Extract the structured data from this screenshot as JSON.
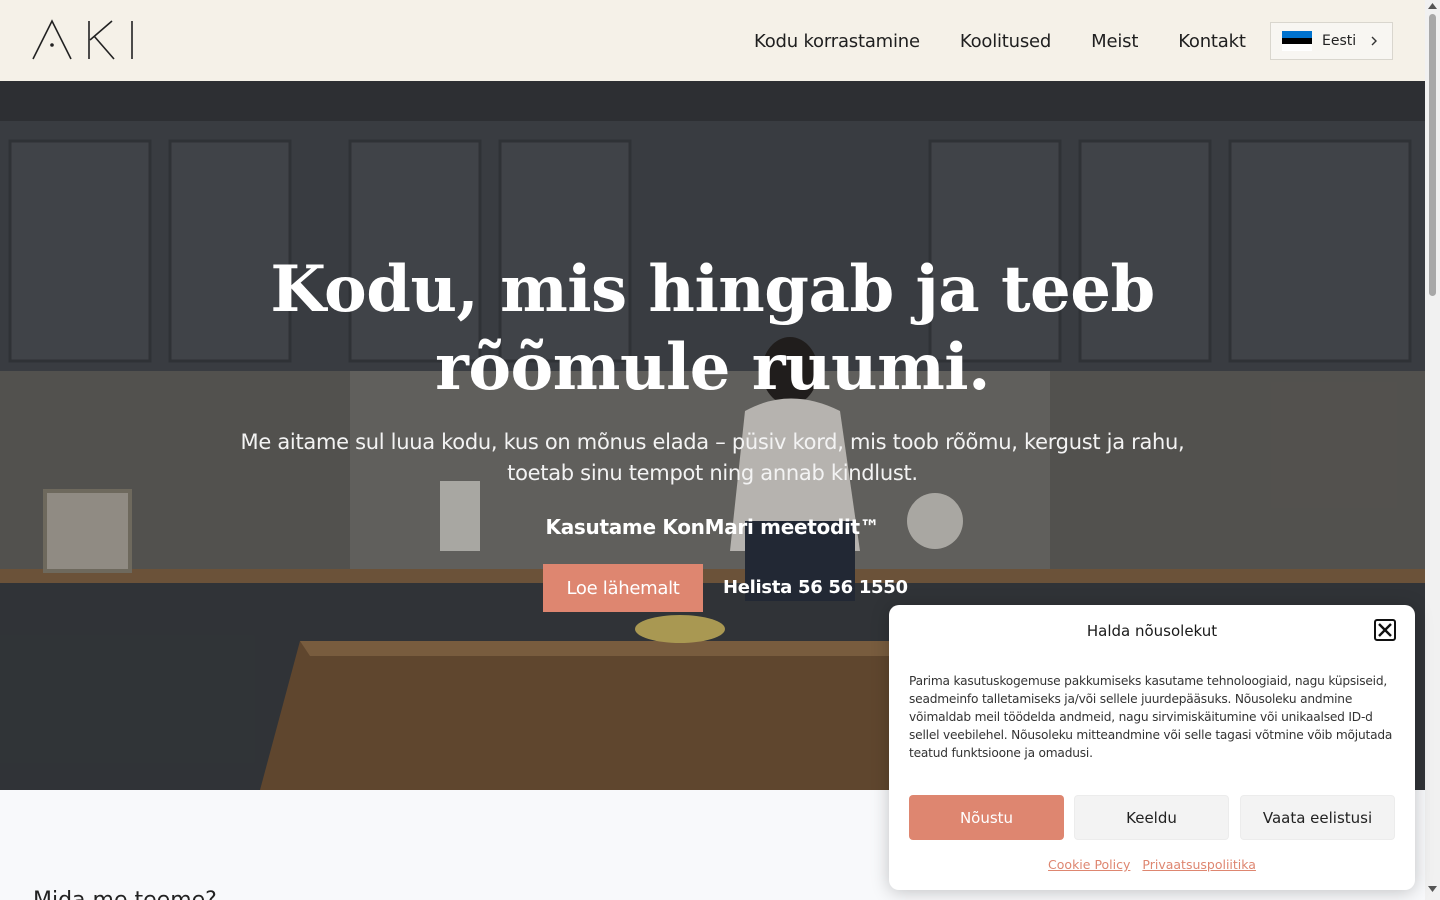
{
  "header": {
    "logo_text": "AKI",
    "nav": [
      {
        "label": "Kodu korrastamine"
      },
      {
        "label": "Koolitused"
      },
      {
        "label": "Meist"
      },
      {
        "label": "Kontakt"
      }
    ],
    "language": {
      "label": "Eesti",
      "flag_colors": [
        "#0072ce",
        "#000000",
        "#ffffff"
      ]
    }
  },
  "hero": {
    "title": "Kodu, mis hingab ja teeb rõõmule ruumi.",
    "subtitle": "Me aitame sul luua kodu, kus on mõnus elada – püsiv kord, mis toob rõõmu, kergust ja rahu, toetab sinu tempot ning annab kindlust.",
    "method": "Kasutame KonMari meetodit™",
    "cta_label": "Loe lähemalt",
    "call_label": "Helista",
    "phone": "56 56 1550"
  },
  "section": {
    "heading_partial": "Mida me teeme?"
  },
  "consent": {
    "title": "Halda nõusolekut",
    "text": "Parima kasutuskogemuse pakkumiseks kasutame tehnoloogiaid, nagu küpsiseid, seadmeinfo talletamiseks ja/või sellele juurdepääsuks. Nõusoleku andmine võimaldab meil töödelda andmeid, nagu sirvimiskäitumine või unikaalsed ID-d sellel veebilehel. Nõusoleku mitteandmine või selle tagasi võtmine võib mõjutada teatud funktsioone ja omadusi.",
    "accept_label": "Nõustu",
    "deny_label": "Keeldu",
    "prefs_label": "Vaata eelistusi",
    "links": [
      "Cookie Policy",
      "Privaatsuspoliitika"
    ]
  },
  "colors": {
    "accent": "#de8670",
    "header_bg": "#f5f1e8"
  }
}
